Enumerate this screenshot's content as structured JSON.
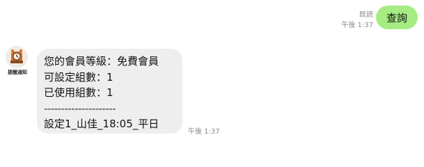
{
  "outgoing": {
    "read_status": "既読",
    "time": "午後 1:37",
    "text": "查詢"
  },
  "incoming": {
    "sender_label": "提醒通知",
    "lines": [
      "您的會員等級：免費會員",
      "可設定組數：1",
      "已使用組數：1",
      "---------------------",
      "設定1_山佳_18:05_平日"
    ],
    "time": "午後 1:37"
  },
  "colors": {
    "outgoing_bubble": "#a5ec83",
    "incoming_bubble": "#eeeeee",
    "timestamp": "#8a8a8a"
  },
  "icons": {
    "avatar": "clock-badge-icon"
  }
}
